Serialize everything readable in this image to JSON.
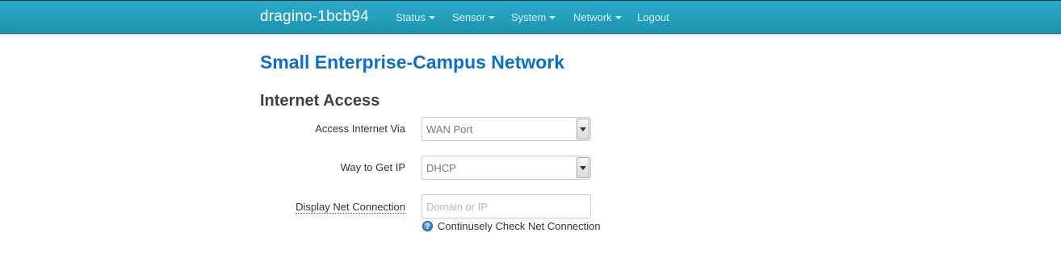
{
  "navbar": {
    "brand": "dragino-1bcb94",
    "items": [
      {
        "label": "Status",
        "dropdown": true
      },
      {
        "label": "Sensor",
        "dropdown": true
      },
      {
        "label": "System",
        "dropdown": true
      },
      {
        "label": "Network",
        "dropdown": true
      },
      {
        "label": "Logout",
        "dropdown": false
      }
    ]
  },
  "page": {
    "title": "Small Enterprise-Campus Network",
    "section_title": "Internet Access"
  },
  "form": {
    "access_internet_via": {
      "label": "Access Internet Via",
      "value": "WAN Port"
    },
    "way_to_get_ip": {
      "label": "Way to Get IP",
      "value": "DHCP"
    },
    "display_net_connection": {
      "label": "Display Net Connection",
      "value": "",
      "placeholder": "Domain or IP",
      "help_text": "Continusely Check Net Connection"
    }
  },
  "icons": {
    "help": "question-circle-icon",
    "caret": "caret-down-icon"
  },
  "colors": {
    "navbar": "#1f9bb8",
    "title": "#0a6ed1"
  }
}
